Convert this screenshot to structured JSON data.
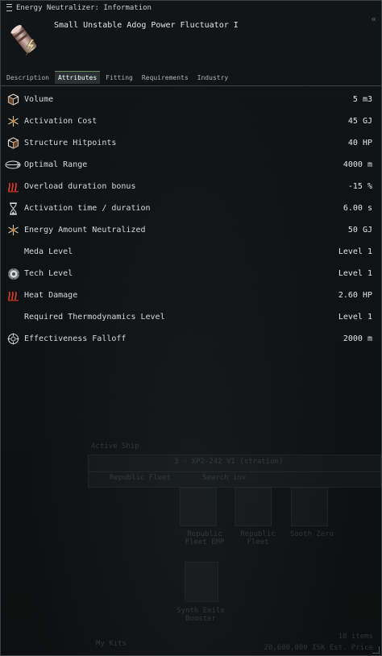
{
  "window": {
    "title": "Energy Neutralizer: Information",
    "controls": "«",
    "icon": "menu-icon"
  },
  "item": {
    "name": "Small Unstable Adog Power Fluctuator I",
    "icon": "energy-neutralizer-icon"
  },
  "tabs": [
    {
      "label": "Description",
      "active": false
    },
    {
      "label": "Attributes",
      "active": true
    },
    {
      "label": "Fitting",
      "active": false
    },
    {
      "label": "Requirements",
      "active": false
    },
    {
      "label": "Industry",
      "active": false
    }
  ],
  "attributes": [
    {
      "label": "Volume",
      "value": "5 m3",
      "icon": "volume-cube-icon"
    },
    {
      "label": "Activation Cost",
      "value": "45 GJ",
      "icon": "capacitor-spark-icon"
    },
    {
      "label": "Structure Hitpoints",
      "value": "40 HP",
      "icon": "structure-cube-icon"
    },
    {
      "label": "Optimal Range",
      "value": "4000 m",
      "icon": "range-icon"
    },
    {
      "label": "Overload duration bonus",
      "value": "-15 %",
      "icon": "heat-icon"
    },
    {
      "label": "Activation time / duration",
      "value": "6.00 s",
      "icon": "hourglass-icon"
    },
    {
      "label": "Energy Amount Neutralized",
      "value": "50 GJ",
      "icon": "capacitor-spark-icon"
    },
    {
      "label": "Meda Level",
      "value": "Level 1",
      "icon": ""
    },
    {
      "label": "Tech Level",
      "value": "Level 1",
      "icon": "tech-level-icon"
    },
    {
      "label": "Heat Damage",
      "value": "2.60 HP",
      "icon": "heat-icon"
    },
    {
      "label": "Required Thermodynamics Level",
      "value": "Level 1",
      "icon": ""
    },
    {
      "label": "Effectiveness Falloff",
      "value": "2000 m",
      "icon": "falloff-target-icon"
    }
  ],
  "background": {
    "title": "Active Ship",
    "system_label": "3 - XP2-242 VI (stration)",
    "ship_label": "Republic Fleet",
    "search": "Search inv",
    "items": [
      {
        "name": "Republic Fleet EMP"
      },
      {
        "name": "Republic Fleet"
      },
      {
        "name": "Synth Exile Booster"
      },
      {
        "name": "Sooth Zero"
      }
    ],
    "footer_items": "18 items",
    "footer_isk": "20,600,000 ISK Est. Price",
    "my_kits": "My Kits"
  },
  "colors": {
    "accent_green": "#6b8c5c",
    "heat_red": "#d03a1e",
    "text": "#d5d9da"
  }
}
